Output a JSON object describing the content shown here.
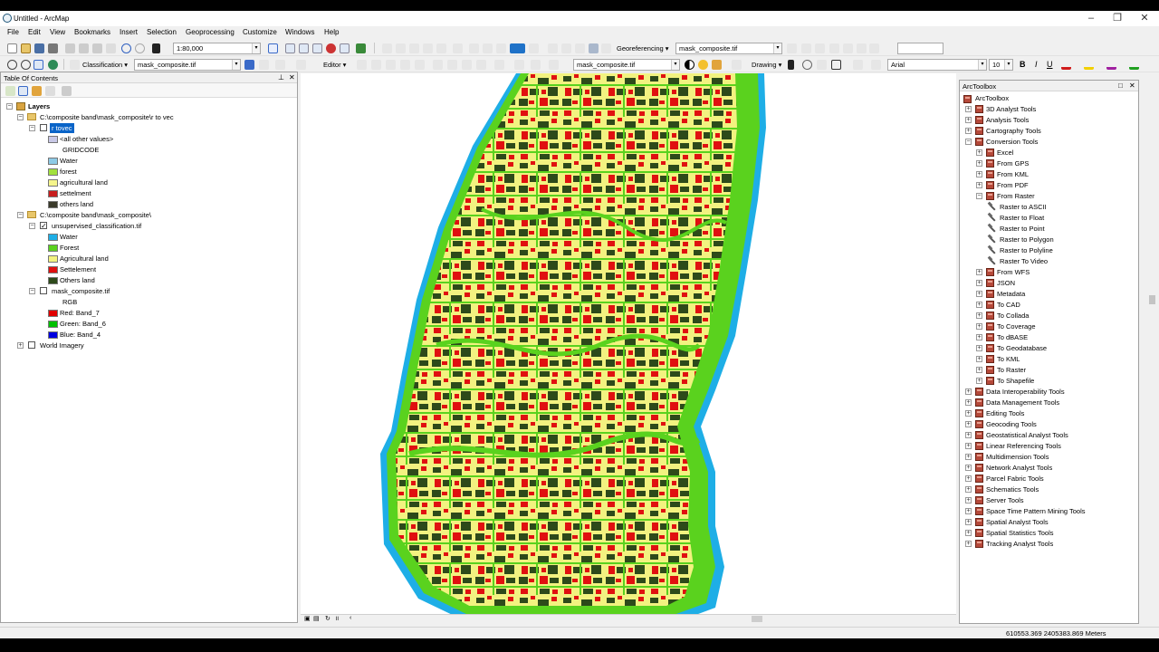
{
  "window": {
    "title": "Untitled - ArcMap"
  },
  "menu": [
    "File",
    "Edit",
    "View",
    "Bookmarks",
    "Insert",
    "Selection",
    "Geoprocessing",
    "Customize",
    "Windows",
    "Help"
  ],
  "toolbar1": {
    "scale": "1:80,000",
    "georef_label": "Georeferencing ▾",
    "georef_layer": "mask_composite.tif"
  },
  "toolbar2": {
    "classification_label": "Classification ▾",
    "classification_layer": "mask_composite.tif",
    "editor_label": "Editor ▾",
    "effects_layer": "mask_composite.tif",
    "drawing_label": "Drawing ▾",
    "font": "Arial",
    "font_size": "10",
    "bold": "B",
    "italic": "I",
    "underline": "U"
  },
  "toc": {
    "title": "Table Of Contents",
    "root": "Layers",
    "group1": {
      "path": "C:\\composite band\\mask_composite\\r to vec",
      "layer": "r tovec",
      "field_other": "<all other values>",
      "field": "GRIDCODE",
      "classes": [
        {
          "label": "Water",
          "color": "#8ecae6"
        },
        {
          "label": "forest",
          "color": "#a2e13d"
        },
        {
          "label": "agricultural land",
          "color": "#f5f58c"
        },
        {
          "label": "settelment",
          "color": "#c81e1e"
        },
        {
          "label": "others land",
          "color": "#3a3a2a"
        }
      ]
    },
    "group2": {
      "path": "C:\\composite band\\mask_composite\\",
      "layer": "unsupervised_classification.tif",
      "classes": [
        {
          "label": "Water",
          "color": "#1eaee6"
        },
        {
          "label": "Forest",
          "color": "#5ad21e"
        },
        {
          "label": "Agricultural  land",
          "color": "#f2f280"
        },
        {
          "label": "Settelement",
          "color": "#e01010"
        },
        {
          "label": "Others land",
          "color": "#2d4a1a"
        }
      ],
      "raster": "mask_composite.tif",
      "rgb": "RGB",
      "bands": [
        {
          "label": "Red:    Band_7",
          "color": "#e00000"
        },
        {
          "label": "Green: Band_6",
          "color": "#00c000"
        },
        {
          "label": "Blue:   Band_4",
          "color": "#0000e0"
        }
      ]
    },
    "basemap": "World Imagery"
  },
  "arctoolbox": {
    "title": "ArcToolbox",
    "root": "ArcToolbox",
    "items": [
      "3D Analyst Tools",
      "Analysis Tools",
      "Cartography Tools",
      "Conversion Tools",
      "Excel",
      "From GPS",
      "From KML",
      "From PDF",
      "From Raster",
      "Raster to ASCII",
      "Raster to Float",
      "Raster to Point",
      "Raster to Polygon",
      "Raster to Polyline",
      "Raster To Video",
      "From WFS",
      "JSON",
      "Metadata",
      "To CAD",
      "To Collada",
      "To Coverage",
      "To dBASE",
      "To Geodatabase",
      "To KML",
      "To Raster",
      "To Shapefile",
      "Data Interoperability Tools",
      "Data Management Tools",
      "Editing Tools",
      "Geocoding Tools",
      "Geostatistical Analyst Tools",
      "Linear Referencing Tools",
      "Multidimension Tools",
      "Network Analyst Tools",
      "Parcel Fabric Tools",
      "Schematics Tools",
      "Server Tools",
      "Space Time Pattern Mining Tools",
      "Spatial Analyst Tools",
      "Spatial Statistics Tools",
      "Tracking Analyst Tools"
    ]
  },
  "status": {
    "coords": "610553.369  2405383.869 Meters"
  },
  "colors": {
    "water": "#1eaee6",
    "forest": "#5ad21e",
    "agri": "#f2f280",
    "settlement": "#e01010",
    "others": "#2d4a1a"
  }
}
